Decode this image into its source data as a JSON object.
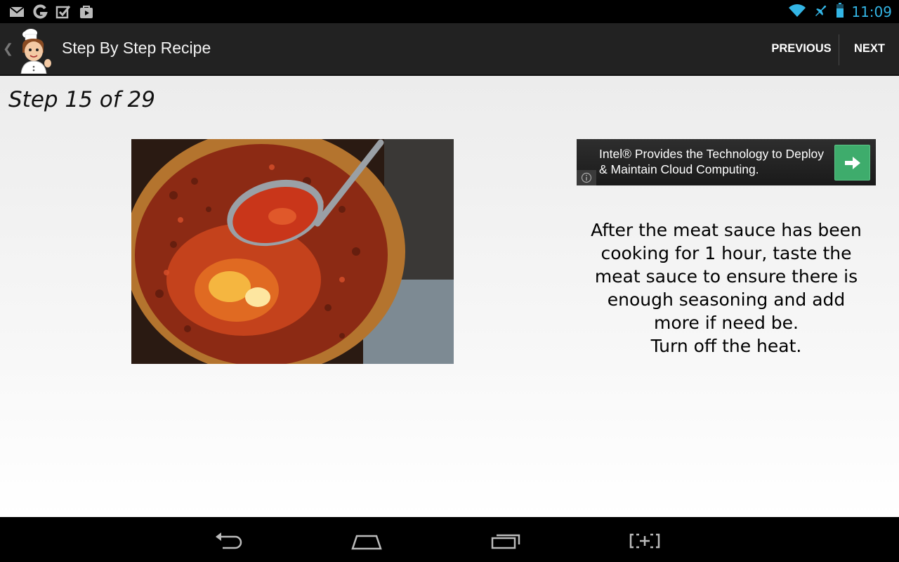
{
  "status_bar": {
    "time": "11:09",
    "left_icons": [
      "gmail-icon",
      "google-g-icon",
      "tasks-check-icon",
      "play-store-icon"
    ],
    "right_icons": [
      "wifi-icon",
      "airplane-mode-icon",
      "battery-icon"
    ],
    "accent_color": "#33b5e5"
  },
  "action_bar": {
    "title": "Step By Step Recipe",
    "previous_label": "PREVIOUS",
    "next_label": "NEXT",
    "app_icon": "chef-icon"
  },
  "step": {
    "label": "Step 15 of 29",
    "image": "meat-sauce-pan-photo",
    "text": "After the meat sauce has been cooking for 1 hour, taste the meat sauce to ensure there is enough seasoning and add more if need be.\nTurn off the heat."
  },
  "ad": {
    "text": "Intel® Provides the Technology to Deploy & Maintain Cloud Computing.",
    "button_color": "#3eac6c"
  },
  "nav_bar": {
    "buttons": [
      "back-icon",
      "home-icon",
      "recent-apps-icon",
      "screenshot-icon"
    ]
  }
}
